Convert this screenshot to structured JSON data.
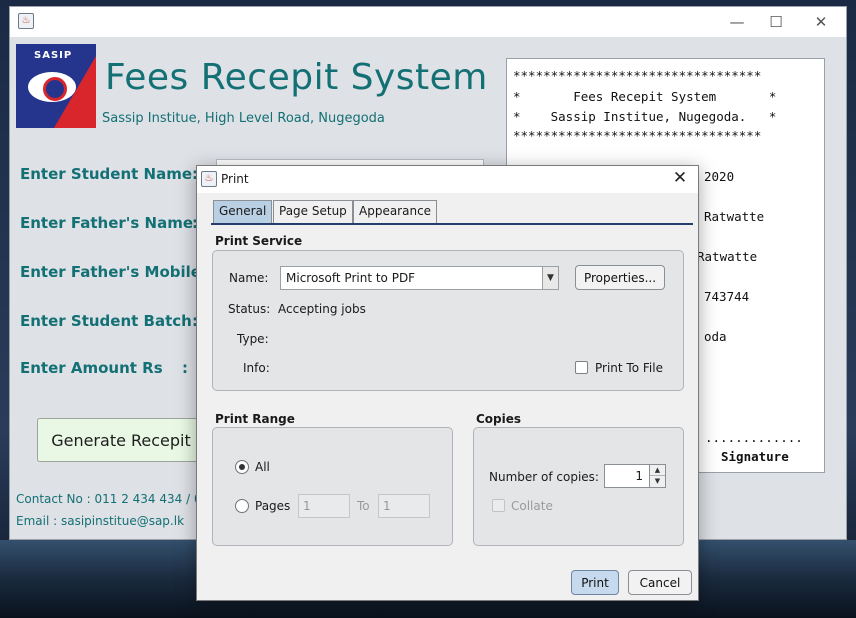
{
  "app": {
    "title": "Fees Recepit System",
    "subtitle": "Sassip Institue, High Level Road, Nugegoda",
    "logo_text": "SASIP",
    "fields": [
      {
        "label": "Enter Student Name"
      },
      {
        "label": "Enter Father's Name"
      },
      {
        "label": "Enter Father's Mobile"
      },
      {
        "label": "Enter Student Batch"
      },
      {
        "label": "Enter Amount Rs"
      }
    ],
    "colon": ":",
    "generate_label": "Generate Recepit",
    "contact": "Contact No : 011 2 434 434 / 01",
    "email": "Email : sasipinstitue@sap.lk"
  },
  "receipt": {
    "stars": "*********************************",
    "header1": "*       Fees Recepit System       *",
    "header2": "*    Sassip Institue, Nugegoda.   *",
    "line1": "2020",
    "line2": "Ratwatte",
    "line3": "Ratwatte",
    "line4": "743744",
    "line5": "oda",
    "dots": ".............",
    "signature": "Signature"
  },
  "window_controls": {
    "minimize": "—",
    "maximize": "☐",
    "close": "✕"
  },
  "dialog": {
    "title": "Print",
    "close": "✕",
    "tabs": [
      "General",
      "Page Setup",
      "Appearance"
    ],
    "print_service": {
      "heading": "Print Service",
      "name_label": "Name:",
      "name_value": "Microsoft Print to PDF",
      "properties_label": "Properties...",
      "status_label": "Status:",
      "status_value": "Accepting jobs",
      "type_label": "Type:",
      "info_label": "Info:",
      "print_to_file_label": "Print To File"
    },
    "print_range": {
      "heading": "Print Range",
      "all_label": "All",
      "pages_label": "Pages",
      "from_value": "1",
      "to_label": "To",
      "to_value": "1"
    },
    "copies": {
      "heading": "Copies",
      "number_label": "Number of copies:",
      "number_value": "1",
      "collate_label": "Collate"
    },
    "print_button": "Print",
    "cancel_button": "Cancel"
  },
  "icons": {
    "app_icon": "java-cup-icon",
    "select_arrow": "chevron-down-icon"
  }
}
